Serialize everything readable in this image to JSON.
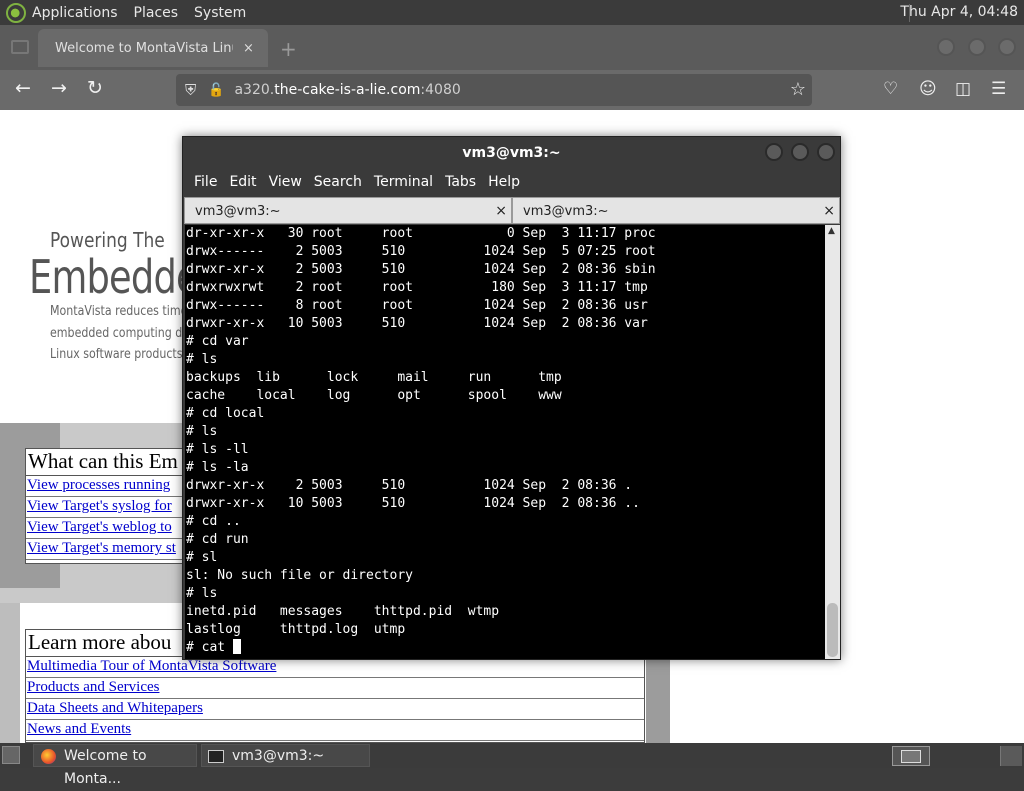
{
  "top_panel": {
    "menus": [
      "Applications",
      "Places",
      "System"
    ],
    "clock": "Thu Apr  4, 04:48"
  },
  "browser": {
    "tab_title": "Welcome to MontaVista Linux",
    "tab_close": "×",
    "new_tab": "+",
    "url_prefix": "a320.",
    "url_domain": "the-cake-is-a-lie.com",
    "url_suffix": ":4080"
  },
  "webpage": {
    "tagline": "Powering The",
    "headline": "Embedded",
    "intro_lines": [
      "MontaVista reduces time-to",
      "embedded computing deve",
      "Linux software products an"
    ],
    "section1_title": "What can this Em",
    "section1_links": [
      "View processes running",
      "View Target's syslog for",
      "View Target's weblog to",
      "View Target's memory st"
    ],
    "section2_title": "Learn more abou",
    "section2_links": [
      "Multimedia Tour of MontaVista Software",
      "Products and Services",
      "Data Sheets and Whitepapers",
      "News and Events"
    ]
  },
  "terminal": {
    "title": "vm3@vm3:~",
    "menus": [
      "File",
      "Edit",
      "View",
      "Search",
      "Terminal",
      "Tabs",
      "Help"
    ],
    "tabs": [
      {
        "label": "vm3@vm3:~",
        "close": "×"
      },
      {
        "label": "vm3@vm3:~",
        "close": "×"
      }
    ],
    "lines": [
      "dr-xr-xr-x   30 root     root            0 Sep  3 11:17 proc",
      "drwx------    2 5003     510          1024 Sep  5 07:25 root",
      "drwxr-xr-x    2 5003     510          1024 Sep  2 08:36 sbin",
      "drwxrwxrwt    2 root     root          180 Sep  3 11:17 tmp",
      "drwx------    8 root     root         1024 Sep  2 08:36 usr",
      "drwxr-xr-x   10 5003     510          1024 Sep  2 08:36 var",
      "# cd var",
      "# ls",
      "backups  lib      lock     mail     run      tmp",
      "cache    local    log      opt      spool    www",
      "# cd local",
      "# ls",
      "# ls -ll",
      "# ls -la",
      "drwxr-xr-x    2 5003     510          1024 Sep  2 08:36 .",
      "drwxr-xr-x   10 5003     510          1024 Sep  2 08:36 ..",
      "# cd ..",
      "# cd run",
      "# sl",
      "sl: No such file or directory",
      "# ls",
      "inetd.pid   messages    thttpd.pid  wtmp",
      "lastlog     thttpd.log  utmp"
    ],
    "prompt": "# cat "
  },
  "taskbar": {
    "items": [
      "Welcome to Monta...",
      "vm3@vm3:~"
    ]
  }
}
